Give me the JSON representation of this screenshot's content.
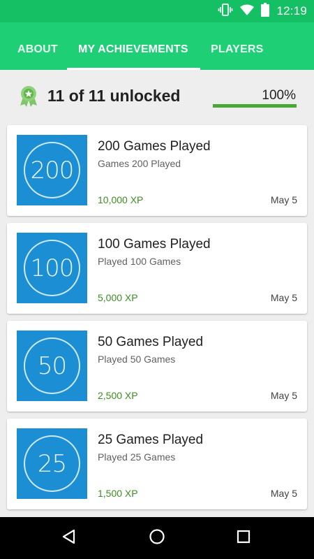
{
  "status_bar": {
    "time": "12:19",
    "icons": [
      "vibrate-icon",
      "wifi-icon",
      "battery-icon"
    ]
  },
  "tabs": [
    {
      "label": "ABOUT",
      "selected": false
    },
    {
      "label": "MY ACHIEVEMENTS",
      "selected": true
    },
    {
      "label": "PLAYERS",
      "selected": false
    }
  ],
  "summary": {
    "icon": "achievement-badge-icon",
    "unlocked_text": "11 of 11 unlocked",
    "percent_text": "100%",
    "progress": 1.0
  },
  "achievements": [
    {
      "badge_number": "200",
      "title": "200 Games Played",
      "description": "Games 200 Played",
      "xp": "10,000 XP",
      "date": "May 5"
    },
    {
      "badge_number": "100",
      "title": "100 Games Played",
      "description": "Played 100 Games",
      "xp": "5,000 XP",
      "date": "May 5"
    },
    {
      "badge_number": "50",
      "title": "50 Games Played",
      "description": "Played 50 Games",
      "xp": "2,500 XP",
      "date": "May 5"
    },
    {
      "badge_number": "25",
      "title": "25 Games Played",
      "description": "Played 25 Games",
      "xp": "1,500 XP",
      "date": "May 5"
    }
  ],
  "nav_bar": {
    "buttons": [
      "back-icon",
      "home-icon",
      "recents-icon"
    ]
  },
  "colors": {
    "status_bar": "#15c064",
    "tab_bar": "#1ecf76",
    "tile": "#1c8ed4",
    "xp_text": "#3c8f1e",
    "progress": "#4aa836"
  }
}
